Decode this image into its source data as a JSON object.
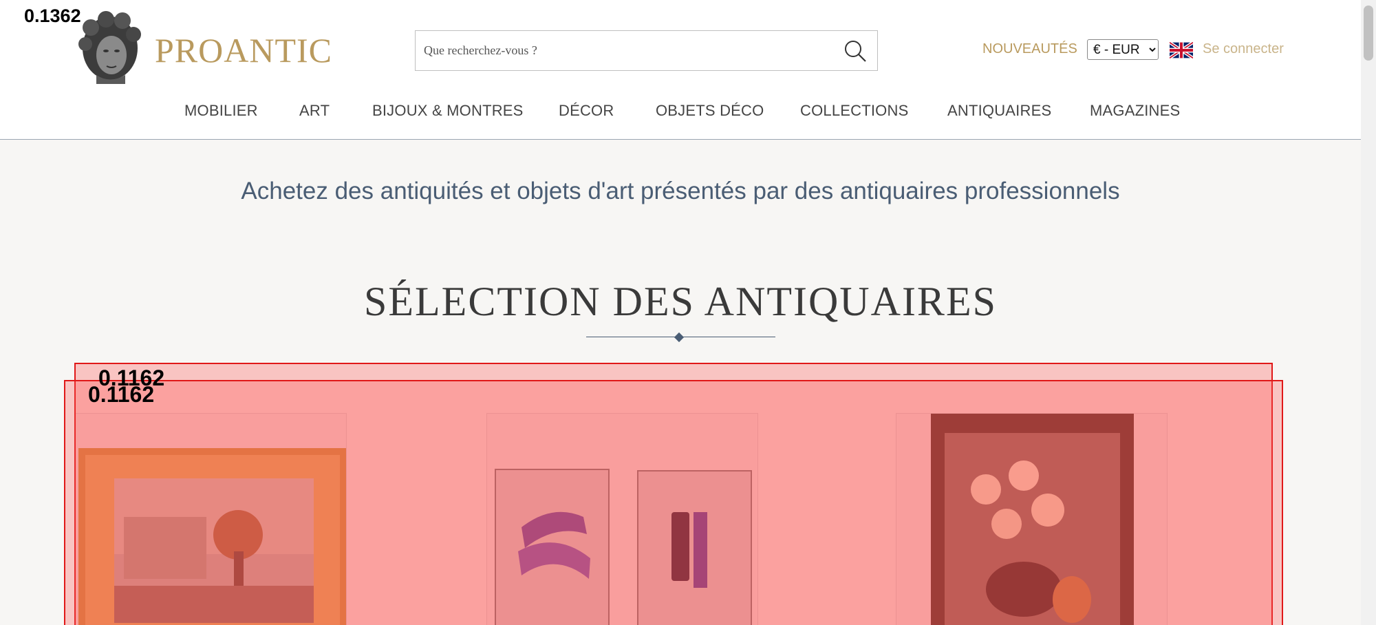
{
  "brand": {
    "name": "PROANTIC"
  },
  "search": {
    "placeholder": "Que recherchez-vous ?"
  },
  "header": {
    "nouveautes": "NOUVEAUTÉS",
    "currency": {
      "selected": "€ - EUR",
      "options": [
        "€ - EUR"
      ]
    },
    "login": "Se connecter"
  },
  "nav": {
    "items": [
      "MOBILIER",
      "ART",
      "BIJOUX & MONTRES",
      "DÉCOR",
      "OBJETS DÉCO",
      "COLLECTIONS",
      "ANTIQUAIRES",
      "MAGAZINES"
    ]
  },
  "main": {
    "tagline": "Achetez des antiquités et objets d'art présentés par des antiquaires professionnels",
    "section_title": "SÉLECTION DES ANTIQUAIRES"
  },
  "overlays": {
    "corner_label": "0.1362",
    "labels": [
      "0.1162",
      "0.1162"
    ]
  },
  "colors": {
    "accent_gold": "#b99a5e",
    "heading_blue": "#4a5d74",
    "overlay_red": "#e01818"
  },
  "icons": [
    "bust-logo-icon",
    "search-icon",
    "uk-flag-icon",
    "chevron-down-icon"
  ]
}
